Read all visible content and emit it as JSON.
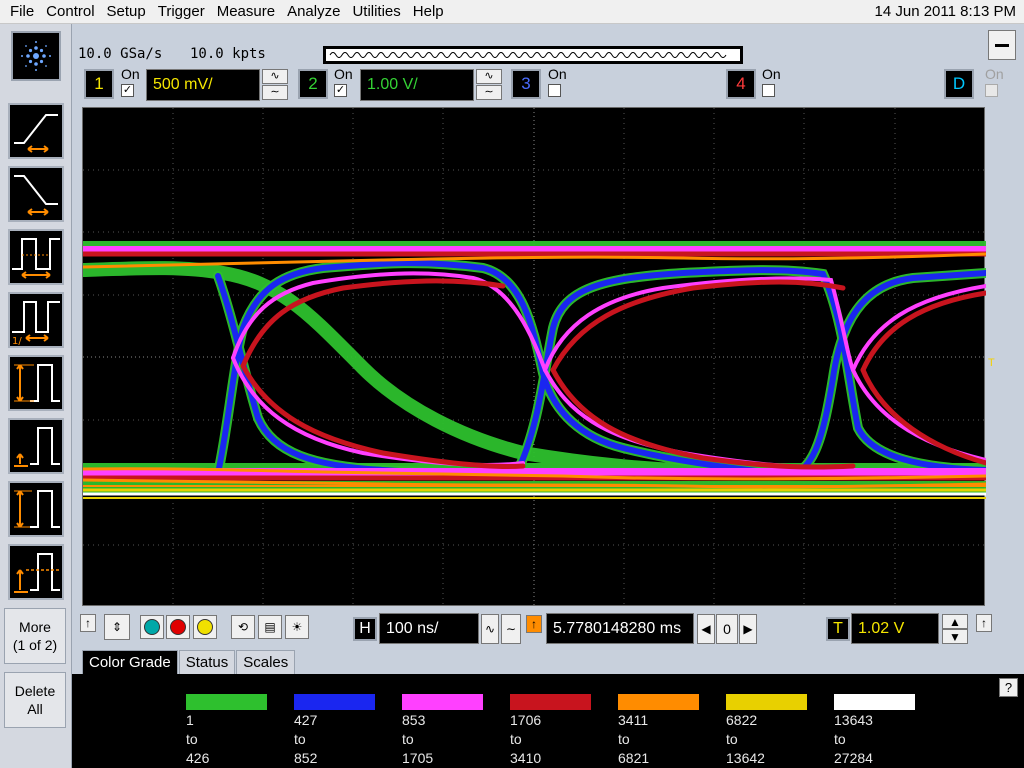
{
  "menu": [
    "File",
    "Control",
    "Setup",
    "Trigger",
    "Measure",
    "Analyze",
    "Utilities",
    "Help"
  ],
  "datetime": "14 Jun 2011  8:13 PM",
  "acquisition": {
    "sample_rate": "10.0 GSa/s",
    "memory": "10.0 kpts"
  },
  "channels": [
    {
      "num": "1",
      "on_label": "On",
      "scale": "500 mV/",
      "color": "#f5e600",
      "checked": true
    },
    {
      "num": "2",
      "on_label": "On",
      "scale": "1.00 V/",
      "color": "#34d234",
      "checked": true
    },
    {
      "num": "3",
      "on_label": "On",
      "color": "#4a6cff",
      "checked": false
    },
    {
      "num": "4",
      "on_label": "On",
      "color": "#ff3b3b",
      "checked": false
    },
    {
      "num": "D",
      "on_label": "On",
      "color": "#00c8ff",
      "checked": false
    }
  ],
  "left_buttons": {
    "more": [
      "More",
      "(1 of 2)"
    ],
    "delete": [
      "Delete",
      "All"
    ]
  },
  "timebase": {
    "h_label": "H",
    "scale": "100 ns/",
    "delay": "5.7780148280 ms",
    "nav_value": "0"
  },
  "trigger": {
    "t_label": "T",
    "level": "1.02 V",
    "marker": "T"
  },
  "tabs": [
    {
      "label": "Color Grade",
      "active": true
    },
    {
      "label": "Status",
      "active": false
    },
    {
      "label": "Scales",
      "active": false
    }
  ],
  "color_grade": [
    {
      "color": "#2ec02e",
      "from": "1",
      "to_word": "to",
      "to": "426"
    },
    {
      "color": "#1a26f0",
      "from": "427",
      "to_word": "to",
      "to": "852"
    },
    {
      "color": "#ff40ff",
      "from": "853",
      "to_word": "to",
      "to": "1705"
    },
    {
      "color": "#c8141e",
      "from": "1706",
      "to_word": "to",
      "to": "3410"
    },
    {
      "color": "#ff8c00",
      "from": "3411",
      "to_word": "to",
      "to": "6821"
    },
    {
      "color": "#e8d000",
      "from": "6822",
      "to_word": "to",
      "to": "13642"
    },
    {
      "color": "#ffffff",
      "from": "13643",
      "to_word": "to",
      "to": "27284"
    }
  ],
  "help_label": "?"
}
